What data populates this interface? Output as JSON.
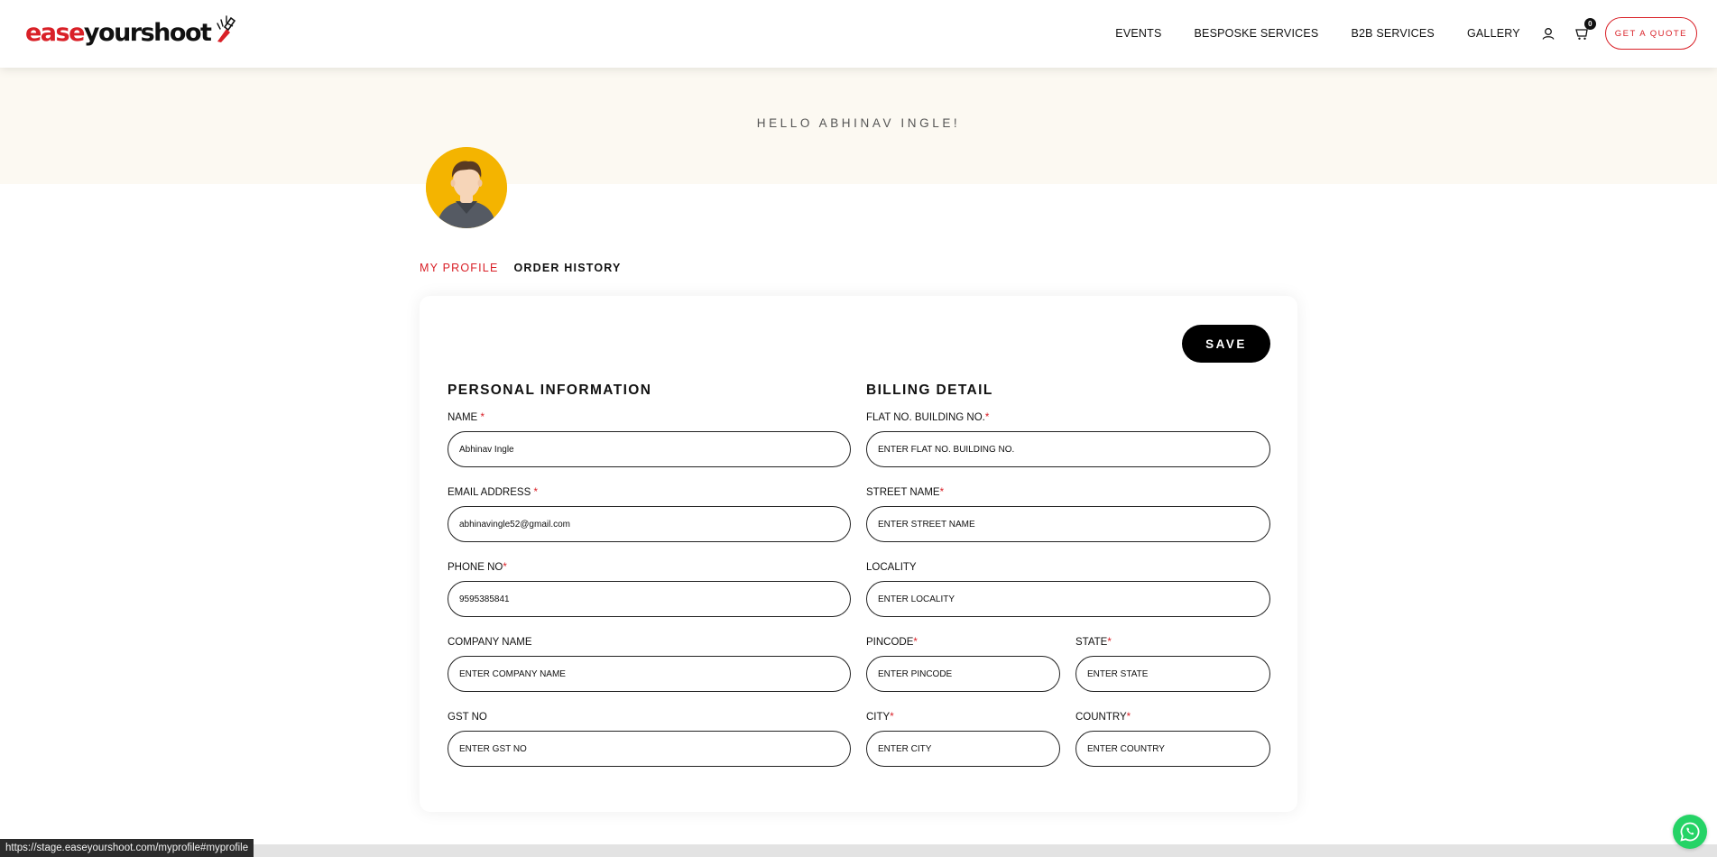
{
  "brand": {
    "logo_part1": "ease",
    "logo_part2": "yourshoot"
  },
  "nav": {
    "links": [
      "EVENTS",
      "BESPOSKE SERVICES",
      "B2B SERVICES",
      "GALLERY"
    ],
    "cart_count": "0",
    "quote_label": "GET A QUOTE"
  },
  "greeting": "HELLO ABHINAV INGLE!",
  "tabs": {
    "my_profile": "MY PROFILE",
    "order_history": "ORDER HISTORY"
  },
  "form": {
    "save_label": "SAVE",
    "personal_title": "PERSONAL INFORMATION",
    "billing_title": "BILLING DETAIL",
    "name": {
      "label": "NAME",
      "value": "Abhinav Ingle",
      "required": true
    },
    "email": {
      "label": "EMAIL ADDRESS",
      "value": "abhinavingle52@gmail.com",
      "required": true
    },
    "phone": {
      "label": "PHONE NO",
      "value": "9595385841",
      "required": true
    },
    "company": {
      "label": "COMPANY NAME",
      "placeholder": "ENTER COMPANY NAME"
    },
    "gst": {
      "label": "GST NO",
      "placeholder": "ENTER GST NO"
    },
    "flat": {
      "label": "FLAT NO. BUILDING NO.",
      "placeholder": "ENTER FLAT NO. BUILDING NO.",
      "required": true
    },
    "street": {
      "label": "STREET NAME",
      "placeholder": "ENTER STREET NAME",
      "required": true
    },
    "locality": {
      "label": "LOCALITY",
      "placeholder": "ENTER LOCALITY"
    },
    "pincode": {
      "label": "PINCODE",
      "placeholder": "ENTER PINCODE",
      "required": true
    },
    "state": {
      "label": "STATE",
      "placeholder": "ENTER STATE",
      "required": true
    },
    "city": {
      "label": "CITY",
      "placeholder": "ENTER CITY",
      "required": true
    },
    "country": {
      "label": "COUNTRY",
      "placeholder": "ENTER COUNTRY",
      "required": true
    }
  },
  "status_url": "https://stage.easeyourshoot.com/myprofile#myprofile",
  "colors": {
    "accent": "#d92027",
    "hero_bg": "#fcf9f2",
    "avatar_bg": "#f4b400",
    "whatsapp": "#25d366"
  }
}
